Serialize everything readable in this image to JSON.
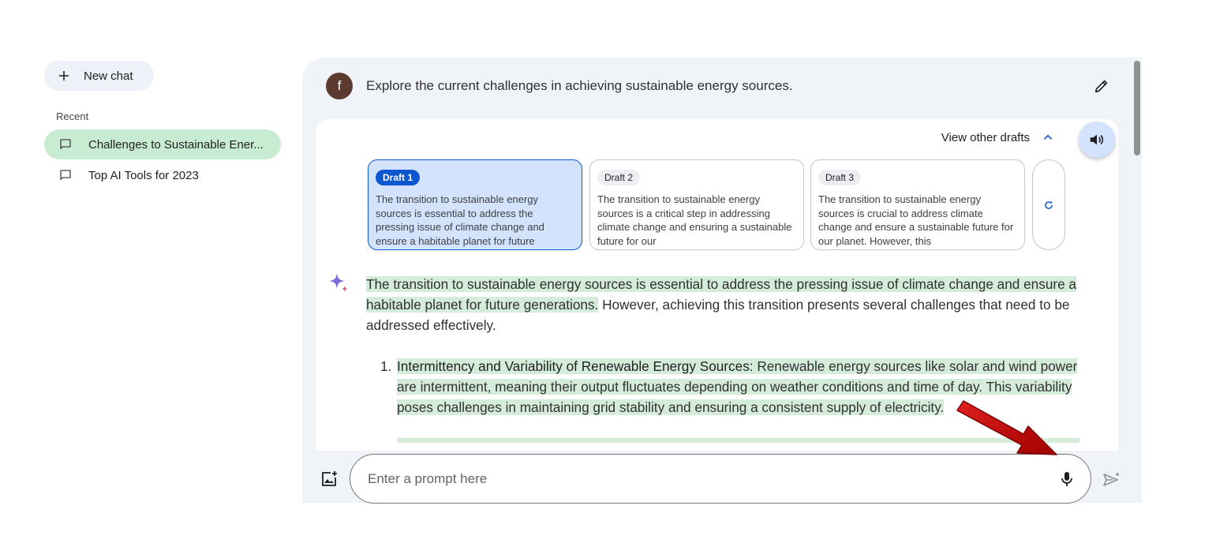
{
  "sidebar": {
    "new_chat_label": "New chat",
    "recent_label": "Recent",
    "items": [
      {
        "label": "Challenges to Sustainable Ener...",
        "active": true
      },
      {
        "label": "Top AI Tools for 2023",
        "active": false
      }
    ]
  },
  "conversation": {
    "user_initial": "f",
    "user_prompt": "Explore the current challenges in achieving sustainable energy sources.",
    "view_drafts_label": "View other drafts",
    "drafts": [
      {
        "badge": "Draft 1",
        "text": "The transition to sustainable energy sources is essential to address the pressing issue of climate change and ensure a habitable planet for future"
      },
      {
        "badge": "Draft 2",
        "text": "The transition to sustainable energy sources is a critical step in addressing climate change and ensuring a sustainable future for our"
      },
      {
        "badge": "Draft 3",
        "text": "The transition to sustainable energy sources is crucial to address climate change and ensure a sustainable future for our planet. However, this"
      }
    ],
    "response": {
      "intro_highlighted": "The transition to sustainable energy sources is essential to address the pressing issue of climate change and ensure a habitable planet for future generations.",
      "intro_rest": " However, achieving this transition presents several challenges that need to be addressed effectively.",
      "list": [
        {
          "number": "1.",
          "title": "Intermittency and Variability of Renewable Energy Sources:",
          "text": " Renewable energy sources like solar and wind power are intermittent, meaning their output fluctuates depending on weather conditions and time of day. This variability poses challenges in maintaining grid stability and ensuring a consistent supply of electricity."
        }
      ]
    }
  },
  "input": {
    "placeholder": "Enter a prompt here"
  },
  "colors": {
    "highlight": "#d4ecd9",
    "accent": "#0b57d0",
    "annotation_arrow": "#c00000"
  },
  "icons": [
    "plus-icon",
    "chat-bubble-icon",
    "pencil-icon",
    "chevron-up-icon",
    "speaker-icon",
    "refresh-icon",
    "gemini-sparkle-icon",
    "add-image-icon",
    "microphone-icon",
    "send-icon"
  ]
}
